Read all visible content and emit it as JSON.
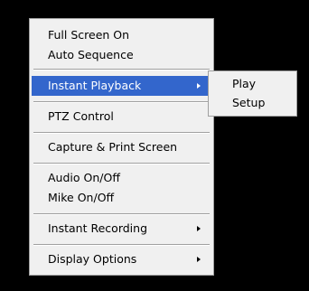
{
  "context_menu": {
    "items": [
      {
        "label": "Full Screen On"
      },
      {
        "label": "Auto Sequence"
      },
      {
        "label": "Instant Playback",
        "submenu": true,
        "selected": true
      },
      {
        "label": "PTZ Control"
      },
      {
        "label": "Capture & Print Screen"
      },
      {
        "label": "Audio On/Off"
      },
      {
        "label": "Mike On/Off"
      },
      {
        "label": "Instant Recording",
        "submenu": true
      },
      {
        "label": "Display Options",
        "submenu": true
      }
    ]
  },
  "submenu": {
    "items": [
      {
        "label": "Play"
      },
      {
        "label": "Setup"
      }
    ]
  },
  "colors": {
    "background": "#000000",
    "menu_bg": "#f0f0f0",
    "highlight": "#3366cc"
  }
}
